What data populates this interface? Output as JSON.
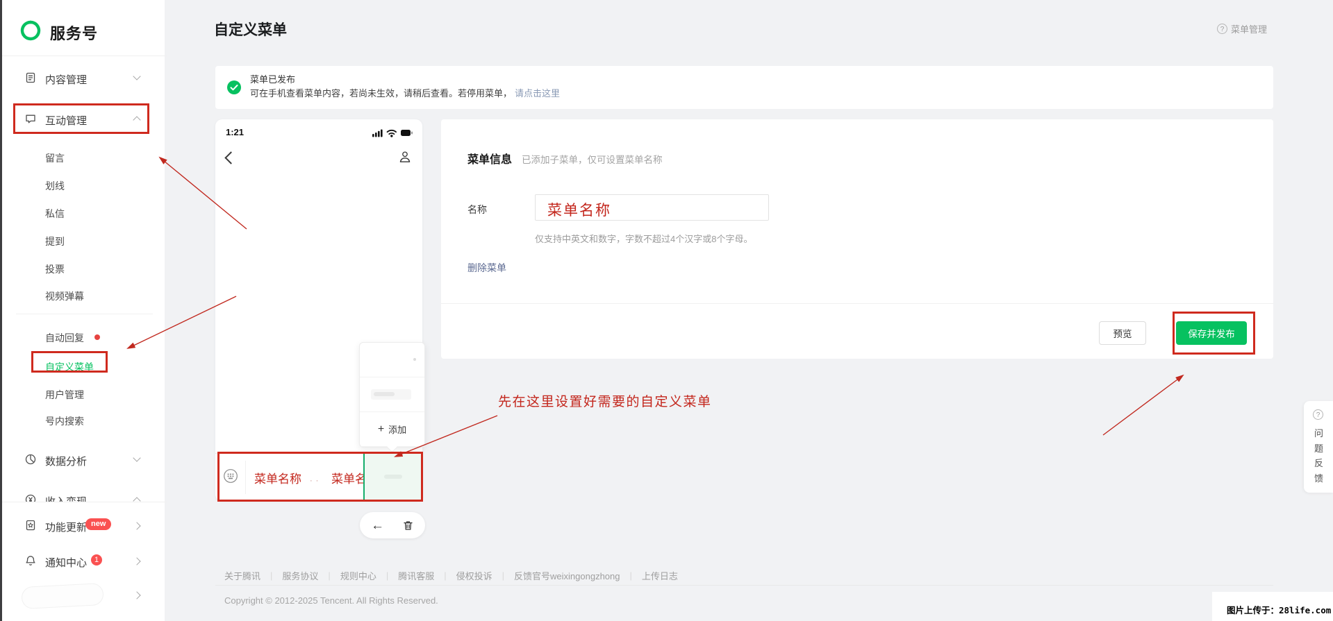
{
  "colors": {
    "brand_green": "#07c160",
    "annotation_red": "#cf2a1e",
    "badge_red": "#fa5151",
    "banner_link_blue": "#8a9ab5",
    "delete_link_blue": "#5d6b92",
    "selected_cell_green": "#eff8f2"
  },
  "sidebar": {
    "logo_text": "服务号",
    "items": [
      {
        "label": "内容管理",
        "icon": "document-icon",
        "chevron": "down"
      },
      {
        "label": "互动管理",
        "icon": "chat-bubble-icon",
        "chevron": "up",
        "highlighted": true
      },
      {
        "label": "留言"
      },
      {
        "label": "划线"
      },
      {
        "label": "私信"
      },
      {
        "label": "提到"
      },
      {
        "label": "投票"
      },
      {
        "label": "视频弹幕"
      },
      {
        "label": "自动回复",
        "dot": true
      },
      {
        "label": "自定义菜单",
        "active": true,
        "highlighted": true
      },
      {
        "label": "用户管理"
      },
      {
        "label": "号内搜索"
      },
      {
        "label": "数据分析",
        "icon": "pie-chart-icon",
        "chevron": "down"
      },
      {
        "label": "收入变现",
        "icon": "money-icon",
        "chevron": "up",
        "clipped": true
      },
      {
        "label": "功能更新",
        "icon": "book-icon",
        "badge": "new",
        "chevron": "right"
      },
      {
        "label": "通知中心",
        "icon": "bell-icon",
        "badge": "1",
        "chevron": "right"
      }
    ]
  },
  "header": {
    "title": "自定义菜单",
    "help_label": "菜单管理",
    "help_icon": "question-circle-icon"
  },
  "banner": {
    "icon": "check-circle-icon",
    "title": "菜单已发布",
    "body": "可在手机查看菜单内容，若尚未生效，请稍后查看。若停用菜单，",
    "link": "请点击这里"
  },
  "phone": {
    "time": "1:21",
    "status_icons": [
      "signal-icon",
      "wifi-icon",
      "battery-icon"
    ],
    "back_icon": "chevron-left-icon",
    "contact_icon": "person-icon",
    "popup": {
      "add_plus": "+",
      "add_label": "添加"
    },
    "menu_items": [
      "菜单名称",
      "菜单名称"
    ],
    "menu_icon": "keyboard-icon"
  },
  "form": {
    "title": "菜单信息",
    "subtitle": "已添加子菜单，仅可设置菜单名称",
    "name_label": "名称",
    "name_value": "菜单名称",
    "hint": "仅支持中英文和数字，字数不超过4个汉字或8个字母。",
    "delete_link": "删除菜单",
    "preview_button": "预览",
    "save_button": "保存并发布"
  },
  "toolbar_pill": {
    "back_icon": "←",
    "trash_icon": "trash-icon"
  },
  "annotation": {
    "text": "先在这里设置好需要的自定义菜单"
  },
  "footer": {
    "links": [
      "关于腾讯",
      "服务协议",
      "规则中心",
      "腾讯客服",
      "侵权投诉",
      "反馈官号weixingongzhong",
      "上传日志"
    ],
    "copyright": "Copyright © 2012-2025 Tencent. All Rights Reserved."
  },
  "feedback_tab": {
    "text": "问题反馈",
    "icon": "question-circle-icon"
  },
  "watermark": {
    "text": "图片上传于：28life.com"
  }
}
